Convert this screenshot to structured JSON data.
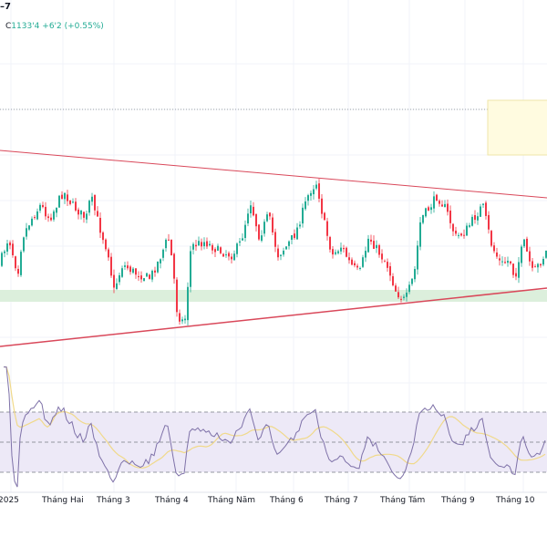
{
  "header": {
    "symbol_suffix": "–7",
    "close_label": "C",
    "close_value": "1133'4",
    "change": "+6'2",
    "change_pct": "(+0.55%)"
  },
  "x_axis": {
    "labels": [
      "2025",
      "Tháng Hai",
      "Tháng 3",
      "Tháng 4",
      "Tháng Năm",
      "Tháng 6",
      "Tháng 7",
      "Tháng Tám",
      "Tháng 9",
      "Tháng 10"
    ]
  },
  "colors": {
    "up": "#22ab94",
    "down": "#f23645",
    "trendline": "#d9485a",
    "support_zone": "#dcefdc",
    "target_zone": "#fffbe0",
    "rsi_line": "#7e71a8",
    "rsi_ma": "#f0d98a",
    "rsi_bg": "#ede9f7"
  }
}
